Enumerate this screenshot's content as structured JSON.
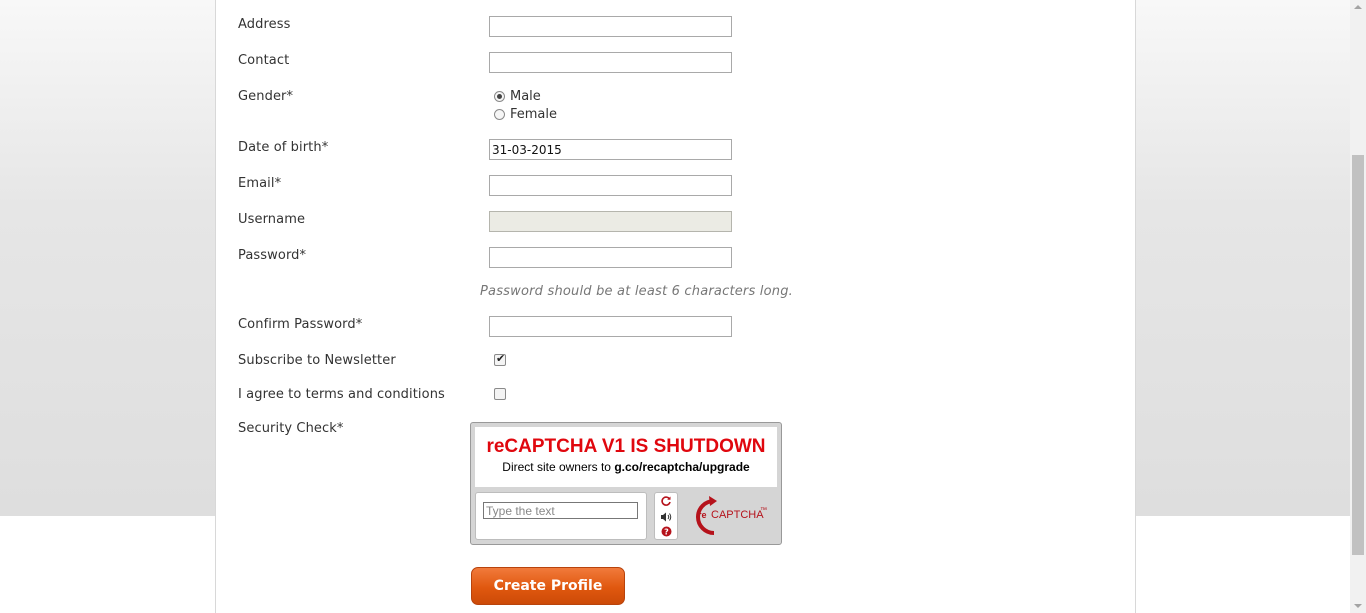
{
  "form": {
    "address_label": "Address",
    "address_value": "",
    "contact_label": "Contact",
    "contact_value": "",
    "gender_label": "Gender*",
    "gender_options": [
      {
        "label": "Male",
        "checked": true
      },
      {
        "label": "Female",
        "checked": false
      }
    ],
    "dob_label": "Date of birth*",
    "dob_value": "31-03-2015",
    "email_label": "Email*",
    "email_value": "",
    "username_label": "Username",
    "username_value": "",
    "password_label": "Password*",
    "password_value": "",
    "password_hint": "Password should be at least 6 characters long.",
    "confirm_password_label": "Confirm Password*",
    "confirm_password_value": "",
    "newsletter_label": "Subscribe to Newsletter",
    "newsletter_checked": true,
    "terms_label": "I agree to terms and conditions",
    "terms_checked": false,
    "security_label": "Security Check*",
    "submit_label": "Create Profile"
  },
  "captcha": {
    "title": "reCAPTCHA V1 IS SHUTDOWN",
    "subtitle_prefix": "Direct site owners to ",
    "subtitle_link": "g.co/recaptcha/upgrade",
    "placeholder": "Type the text",
    "reload_icon": "refresh-icon",
    "audio_icon": "speaker-icon",
    "help_icon": "question-icon",
    "logo_text_re": "re",
    "logo_text_captcha": "CAPTCHA",
    "logo_tm": "™"
  },
  "colors": {
    "button": "#e0580f",
    "captcha_title": "#e0070e",
    "captcha_logo": "#b5121b"
  }
}
